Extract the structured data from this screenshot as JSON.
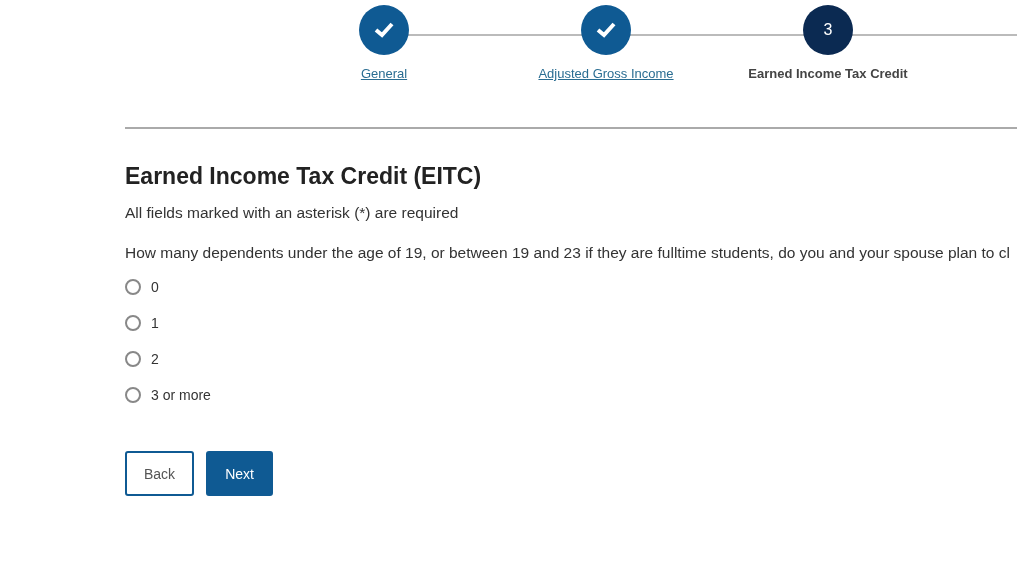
{
  "stepper": [
    {
      "label": "General",
      "completed": true
    },
    {
      "label": "Adjusted Gross Income",
      "completed": true
    },
    {
      "label": "Earned Income Tax Credit",
      "completed": false,
      "number": "3"
    }
  ],
  "heading": "Earned Income Tax Credit (EITC)",
  "required_note": "All fields marked with an asterisk (*) are required",
  "question": "How many dependents under the age of 19, or between 19 and 23 if they are fulltime students, do you and your spouse plan to cl",
  "options": [
    {
      "label": "0",
      "selected": false
    },
    {
      "label": "1",
      "selected": false
    },
    {
      "label": "2",
      "selected": false
    },
    {
      "label": "3 or more",
      "selected": false
    }
  ],
  "buttons": [
    {
      "label": "Back",
      "kind": "secondary"
    },
    {
      "label": "Next",
      "kind": "primary"
    }
  ]
}
